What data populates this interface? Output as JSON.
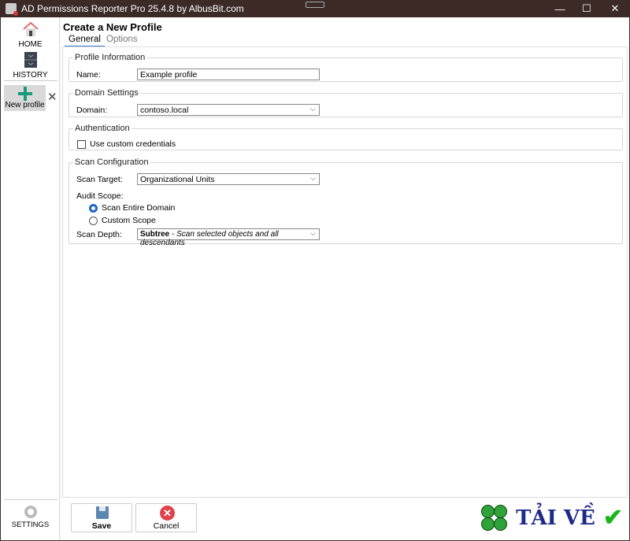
{
  "window": {
    "title": "AD Permissions Reporter Pro 25.4.8 by AlbusBit.com"
  },
  "sidebar": {
    "items": [
      {
        "label": "HOME",
        "icon": "home-icon"
      },
      {
        "label": "HISTORY",
        "icon": "history-icon"
      }
    ],
    "open_profile": "New profile",
    "settings": "SETTINGS"
  },
  "page": {
    "title": "Create a New Profile",
    "tabs": [
      {
        "label": "General",
        "active": true
      },
      {
        "label": "Options",
        "active": false
      }
    ]
  },
  "profile_info": {
    "legend": "Profile Information",
    "name_label": "Name:",
    "name_value": "Example profile"
  },
  "domain_settings": {
    "legend": "Domain Settings",
    "domain_label": "Domain:",
    "domain_value": "contoso.local"
  },
  "authentication": {
    "legend": "Authentication",
    "custom_credentials_label": "Use custom credentials",
    "custom_credentials_checked": false
  },
  "scan_config": {
    "legend": "Scan Configuration",
    "target_label": "Scan Target:",
    "target_value": "Organizational Units",
    "audit_scope_label": "Audit Scope:",
    "scope_options": [
      {
        "label": "Scan Entire Domain",
        "selected": true
      },
      {
        "label": "Custom Scope",
        "selected": false
      }
    ],
    "depth_label": "Scan Depth:",
    "depth_value_bold": "Subtree",
    "depth_value_sep": " - ",
    "depth_value_desc": "Scan selected objects and all descendants"
  },
  "footer": {
    "save": "Save",
    "cancel": "Cancel"
  },
  "watermark": {
    "text": "TẢI VỀ"
  },
  "colors": {
    "titlebar": "#3b2a26",
    "accent": "#3a7bd5",
    "plus": "#1a9a7a"
  }
}
